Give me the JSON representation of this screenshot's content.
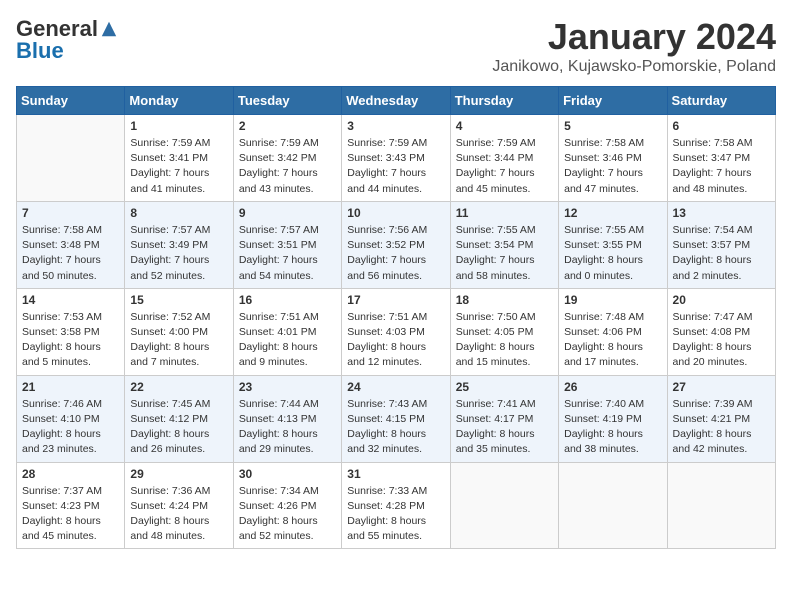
{
  "header": {
    "logo_general": "General",
    "logo_blue": "Blue",
    "month_year": "January 2024",
    "location": "Janikowo, Kujawsko-Pomorskie, Poland"
  },
  "weekdays": [
    "Sunday",
    "Monday",
    "Tuesday",
    "Wednesday",
    "Thursday",
    "Friday",
    "Saturday"
  ],
  "weeks": [
    [
      {
        "day": "",
        "info": ""
      },
      {
        "day": "1",
        "info": "Sunrise: 7:59 AM\nSunset: 3:41 PM\nDaylight: 7 hours\nand 41 minutes."
      },
      {
        "day": "2",
        "info": "Sunrise: 7:59 AM\nSunset: 3:42 PM\nDaylight: 7 hours\nand 43 minutes."
      },
      {
        "day": "3",
        "info": "Sunrise: 7:59 AM\nSunset: 3:43 PM\nDaylight: 7 hours\nand 44 minutes."
      },
      {
        "day": "4",
        "info": "Sunrise: 7:59 AM\nSunset: 3:44 PM\nDaylight: 7 hours\nand 45 minutes."
      },
      {
        "day": "5",
        "info": "Sunrise: 7:58 AM\nSunset: 3:46 PM\nDaylight: 7 hours\nand 47 minutes."
      },
      {
        "day": "6",
        "info": "Sunrise: 7:58 AM\nSunset: 3:47 PM\nDaylight: 7 hours\nand 48 minutes."
      }
    ],
    [
      {
        "day": "7",
        "info": "Sunrise: 7:58 AM\nSunset: 3:48 PM\nDaylight: 7 hours\nand 50 minutes."
      },
      {
        "day": "8",
        "info": "Sunrise: 7:57 AM\nSunset: 3:49 PM\nDaylight: 7 hours\nand 52 minutes."
      },
      {
        "day": "9",
        "info": "Sunrise: 7:57 AM\nSunset: 3:51 PM\nDaylight: 7 hours\nand 54 minutes."
      },
      {
        "day": "10",
        "info": "Sunrise: 7:56 AM\nSunset: 3:52 PM\nDaylight: 7 hours\nand 56 minutes."
      },
      {
        "day": "11",
        "info": "Sunrise: 7:55 AM\nSunset: 3:54 PM\nDaylight: 7 hours\nand 58 minutes."
      },
      {
        "day": "12",
        "info": "Sunrise: 7:55 AM\nSunset: 3:55 PM\nDaylight: 8 hours\nand 0 minutes."
      },
      {
        "day": "13",
        "info": "Sunrise: 7:54 AM\nSunset: 3:57 PM\nDaylight: 8 hours\nand 2 minutes."
      }
    ],
    [
      {
        "day": "14",
        "info": "Sunrise: 7:53 AM\nSunset: 3:58 PM\nDaylight: 8 hours\nand 5 minutes."
      },
      {
        "day": "15",
        "info": "Sunrise: 7:52 AM\nSunset: 4:00 PM\nDaylight: 8 hours\nand 7 minutes."
      },
      {
        "day": "16",
        "info": "Sunrise: 7:51 AM\nSunset: 4:01 PM\nDaylight: 8 hours\nand 9 minutes."
      },
      {
        "day": "17",
        "info": "Sunrise: 7:51 AM\nSunset: 4:03 PM\nDaylight: 8 hours\nand 12 minutes."
      },
      {
        "day": "18",
        "info": "Sunrise: 7:50 AM\nSunset: 4:05 PM\nDaylight: 8 hours\nand 15 minutes."
      },
      {
        "day": "19",
        "info": "Sunrise: 7:48 AM\nSunset: 4:06 PM\nDaylight: 8 hours\nand 17 minutes."
      },
      {
        "day": "20",
        "info": "Sunrise: 7:47 AM\nSunset: 4:08 PM\nDaylight: 8 hours\nand 20 minutes."
      }
    ],
    [
      {
        "day": "21",
        "info": "Sunrise: 7:46 AM\nSunset: 4:10 PM\nDaylight: 8 hours\nand 23 minutes."
      },
      {
        "day": "22",
        "info": "Sunrise: 7:45 AM\nSunset: 4:12 PM\nDaylight: 8 hours\nand 26 minutes."
      },
      {
        "day": "23",
        "info": "Sunrise: 7:44 AM\nSunset: 4:13 PM\nDaylight: 8 hours\nand 29 minutes."
      },
      {
        "day": "24",
        "info": "Sunrise: 7:43 AM\nSunset: 4:15 PM\nDaylight: 8 hours\nand 32 minutes."
      },
      {
        "day": "25",
        "info": "Sunrise: 7:41 AM\nSunset: 4:17 PM\nDaylight: 8 hours\nand 35 minutes."
      },
      {
        "day": "26",
        "info": "Sunrise: 7:40 AM\nSunset: 4:19 PM\nDaylight: 8 hours\nand 38 minutes."
      },
      {
        "day": "27",
        "info": "Sunrise: 7:39 AM\nSunset: 4:21 PM\nDaylight: 8 hours\nand 42 minutes."
      }
    ],
    [
      {
        "day": "28",
        "info": "Sunrise: 7:37 AM\nSunset: 4:23 PM\nDaylight: 8 hours\nand 45 minutes."
      },
      {
        "day": "29",
        "info": "Sunrise: 7:36 AM\nSunset: 4:24 PM\nDaylight: 8 hours\nand 48 minutes."
      },
      {
        "day": "30",
        "info": "Sunrise: 7:34 AM\nSunset: 4:26 PM\nDaylight: 8 hours\nand 52 minutes."
      },
      {
        "day": "31",
        "info": "Sunrise: 7:33 AM\nSunset: 4:28 PM\nDaylight: 8 hours\nand 55 minutes."
      },
      {
        "day": "",
        "info": ""
      },
      {
        "day": "",
        "info": ""
      },
      {
        "day": "",
        "info": ""
      }
    ]
  ]
}
